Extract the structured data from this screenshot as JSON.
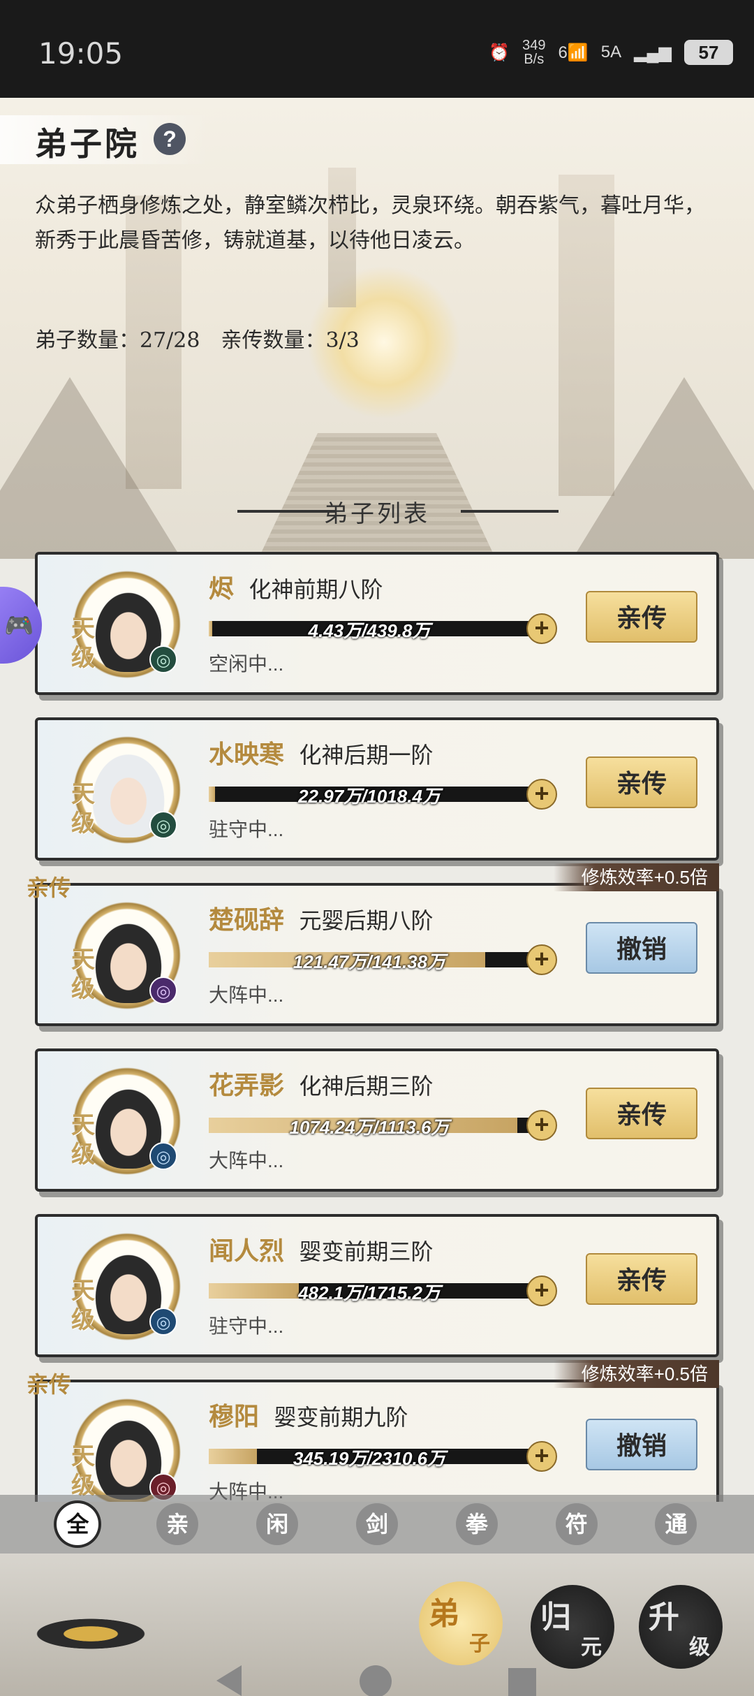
{
  "status_bar": {
    "time": "19:05",
    "net_speed_value": "349",
    "net_speed_unit": "B/s",
    "signal": "5A",
    "wifi_label": "6",
    "battery": "57"
  },
  "header": {
    "title": "弟子院",
    "help": "?",
    "description": "众弟子栖身修炼之处，静室鳞次栉比，灵泉环绕。朝吞紫气，暮吐月华，新秀于此晨昏苦修，铸就道基，以待他日凌云。",
    "disciple_count": "弟子数量：27/28",
    "direct_count": "亲传数量：3/3",
    "section_title": "弟子列表"
  },
  "disciples": [
    {
      "name": "烬",
      "realm": "化神前期八阶",
      "grade": "天级",
      "exp": "4.43万/439.8万",
      "progress": 0.01,
      "status": "空闲中...",
      "action": "亲传",
      "direct": false,
      "element": "green"
    },
    {
      "name": "水映寒",
      "realm": "化神后期一阶",
      "grade": "天级",
      "exp": "22.97万/1018.4万",
      "progress": 0.02,
      "status": "驻守中...",
      "action": "亲传",
      "direct": false,
      "element": "green"
    },
    {
      "name": "楚砚辞",
      "realm": "元婴后期八阶",
      "grade": "天级",
      "exp": "121.47万/141.38万",
      "progress": 0.86,
      "status": "大阵中...",
      "action": "撤销",
      "direct": true,
      "tag": "亲传",
      "efficiency": "修炼效率+0.5倍",
      "element": "purple"
    },
    {
      "name": "花弄影",
      "realm": "化神后期三阶",
      "grade": "天级",
      "exp": "1074.24万/1113.6万",
      "progress": 0.96,
      "status": "大阵中...",
      "action": "亲传",
      "direct": false,
      "element": "blue"
    },
    {
      "name": "闻人烈",
      "realm": "婴变前期三阶",
      "grade": "天级",
      "exp": "482.1万/1715.2万",
      "progress": 0.28,
      "status": "驻守中...",
      "action": "亲传",
      "direct": false,
      "element": "blue"
    },
    {
      "name": "穆阳",
      "realm": "婴变前期九阶",
      "grade": "天级",
      "exp": "345.19万/2310.6万",
      "progress": 0.15,
      "status": "大阵中...",
      "action": "撤销",
      "direct": true,
      "tag": "亲传",
      "efficiency": "修炼效率+0.5倍",
      "element": "red"
    }
  ],
  "filters": [
    "全",
    "亲",
    "闲",
    "剑",
    "拳",
    "符",
    "通"
  ],
  "bottom_nav": {
    "disciples": {
      "big": "弟",
      "small": "子"
    },
    "guiyuan": {
      "big": "归",
      "small": "元"
    },
    "upgrade": {
      "big": "升",
      "small": "级"
    }
  },
  "colors": {
    "accent_gold": "#b48a3e",
    "gold_button": "#e1bf6b",
    "blue_button": "#a7c8e4"
  }
}
